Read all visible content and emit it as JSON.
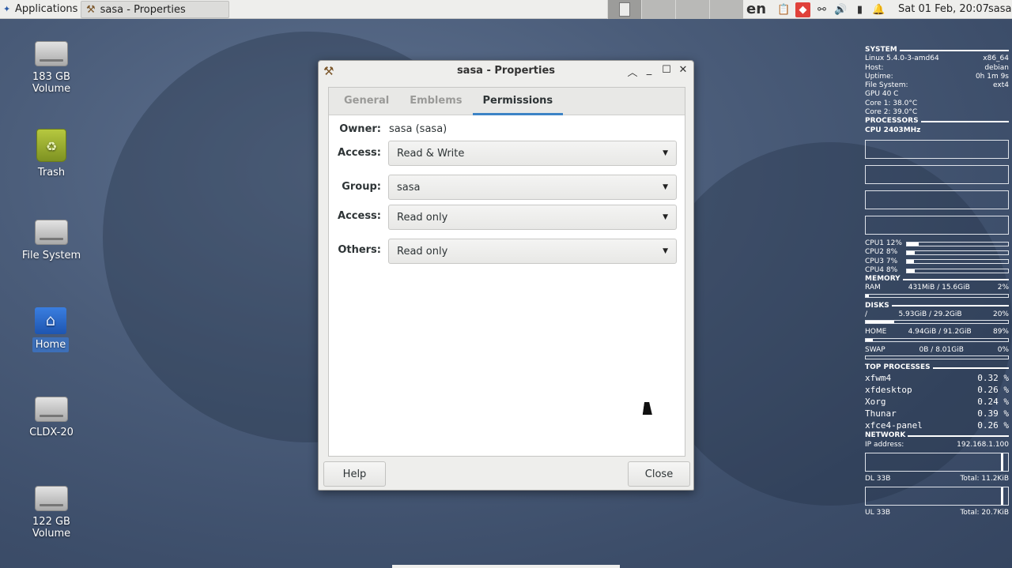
{
  "panel": {
    "applications_label": "Applications",
    "task_title": "sasa - Properties",
    "keyboard_layout": "en",
    "clock": "Sat 01 Feb, 20:07",
    "user": "sasa"
  },
  "desktop": {
    "icons": [
      {
        "label": "183 GB Volume",
        "type": "drive-icon"
      },
      {
        "label": "Trash",
        "type": "trash-icon"
      },
      {
        "label": "File System",
        "type": "drive-icon"
      },
      {
        "label": "Home",
        "type": "home-folder-icon"
      },
      {
        "label": "CLDX-20",
        "type": "drive-icon"
      },
      {
        "label": "122 GB Volume",
        "type": "drive-icon"
      }
    ]
  },
  "window": {
    "title": "sasa - Properties",
    "tabs": [
      "General",
      "Emblems",
      "Permissions"
    ],
    "active_tab": "Permissions",
    "owner_label": "Owner:",
    "owner_value": "sasa (sasa)",
    "owner_access_label": "Access:",
    "owner_access_value": "Read & Write",
    "group_label": "Group:",
    "group_value": "sasa",
    "group_access_label": "Access:",
    "group_access_value": "Read only",
    "others_label": "Others:",
    "others_value": "Read only",
    "help_button": "Help",
    "close_button": "Close"
  },
  "conky": {
    "system_header": "SYSTEM",
    "kernel": "Linux 5.4.0-3-amd64",
    "arch": "x86_64",
    "host_label": "Host:",
    "host_value": "debian",
    "uptime_label": "Uptime:",
    "uptime_value": "0h 1m 9s",
    "fs_label": "File System:",
    "fs_value": "ext4",
    "gpu": "GPU  40 C",
    "core1": "Core 1: 38.0°C",
    "core2": "Core 2: 39.0°C",
    "processors_header": "PROCESSORS",
    "cpu_freq": "CPU  2403MHz",
    "cpus": [
      {
        "name": "CPU1",
        "pct": "12%",
        "value": 0.12
      },
      {
        "name": "CPU2",
        "pct": "8%",
        "value": 0.08
      },
      {
        "name": "CPU3",
        "pct": "7%",
        "value": 0.07
      },
      {
        "name": "CPU4",
        "pct": "8%",
        "value": 0.08
      }
    ],
    "memory_header": "MEMORY",
    "ram_label": "RAM",
    "ram_value": "431MiB / 15.6GiB",
    "ram_pct": "2%",
    "ram_fill": 0.02,
    "disks_header": "DISKS",
    "root_label": "/",
    "root_value": "5.93GiB / 29.2GiB",
    "root_pct": "20%",
    "root_fill": 0.2,
    "home_label": "HOME",
    "home_value": "4.94GiB / 91.2GiB",
    "home_pct": "89%",
    "home_fill": 0.05,
    "swap_label": "SWAP",
    "swap_value": "0B  / 8.01GiB",
    "swap_pct": "0%",
    "swap_fill": 0.0,
    "top_header": "TOP PROCESSES",
    "processes": [
      {
        "name": "xfwm4",
        "pct": "0.32 %"
      },
      {
        "name": "xfdesktop",
        "pct": "0.26 %"
      },
      {
        "name": "Xorg",
        "pct": "0.24 %"
      },
      {
        "name": "Thunar",
        "pct": "0.39 %"
      },
      {
        "name": "xfce4-panel",
        "pct": "0.26 %"
      }
    ],
    "network_header": "NETWORK",
    "ip_label": "IP address:",
    "ip_value": "192.168.1.100",
    "dl_label": "DL  33B",
    "dl_total": "Total: 11.2KiB",
    "ul_label": "UL  33B",
    "ul_total": "Total: 20.7KiB"
  }
}
